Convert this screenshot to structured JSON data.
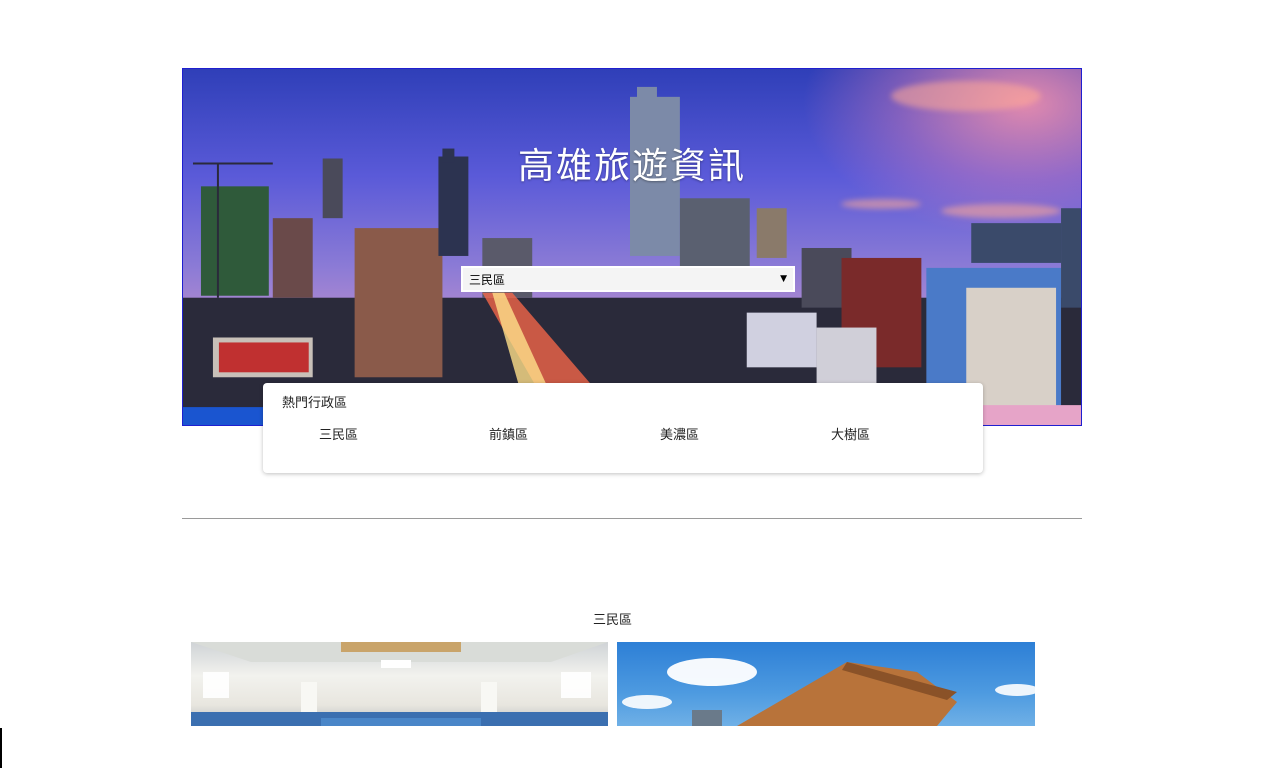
{
  "hero": {
    "title": "高雄旅遊資訊",
    "select": {
      "selected": "三民區",
      "arrow": "▼"
    }
  },
  "hot_districts": {
    "title": "熱門行政區",
    "items": [
      {
        "label": "三民區"
      },
      {
        "label": "前鎮區"
      },
      {
        "label": "美濃區"
      },
      {
        "label": "大樹區"
      }
    ]
  },
  "section": {
    "title": "三民區"
  },
  "colors": {
    "hero_border": "#1f1fd0",
    "divider": "#9a9a9a"
  }
}
